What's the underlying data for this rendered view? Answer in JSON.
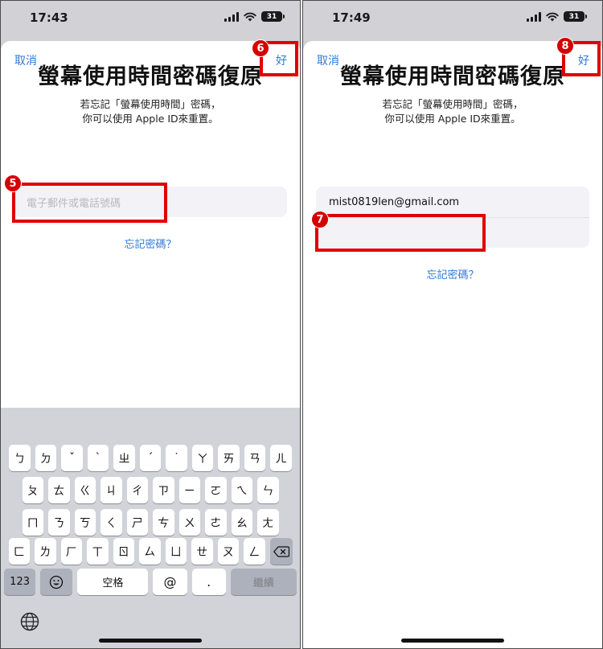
{
  "left": {
    "status_time": "17:43",
    "battery_level": "31",
    "cancel_label": "取消",
    "done_label": "好",
    "title": "螢幕使用時間密碼復原",
    "subtitle_line1": "若忘記「螢幕使用時間」密碼，",
    "subtitle_line2": "你可以使用 Apple ID來重置。",
    "account_placeholder": "電子郵件或電話號碼",
    "forgot_label": "忘記密碼？",
    "badges": [
      "5",
      "6"
    ],
    "keyboard": {
      "row1": [
        "ㄅ",
        "ㄉ",
        "ˇ",
        "ˋ",
        "ㄓ",
        "ˊ",
        "˙",
        "ㄚ",
        "ㄞ",
        "ㄢ",
        "ㄦ"
      ],
      "row2": [
        "ㄆ",
        "ㄊ",
        "ㄍ",
        "ㄐ",
        "ㄔ",
        "ㄗ",
        "ㄧ",
        "ㄛ",
        "ㄟ",
        "ㄣ"
      ],
      "row3": [
        "ㄇ",
        "ㄋ",
        "ㄎ",
        "ㄑ",
        "ㄕ",
        "ㄘ",
        "ㄨ",
        "ㄜ",
        "ㄠ",
        "ㄤ"
      ],
      "row4": [
        "ㄈ",
        "ㄌ",
        "ㄏ",
        "ㄒ",
        "ㄖ",
        "ㄙ",
        "ㄩ",
        "ㄝ",
        "ㄡ",
        "ㄥ"
      ],
      "numbers_label": "123",
      "space_label": "空格",
      "at_label": "@",
      "dot_label": ".",
      "continue_label": "繼續"
    }
  },
  "right": {
    "status_time": "17:49",
    "battery_level": "31",
    "cancel_label": "取消",
    "done_label": "好",
    "title": "螢幕使用時間密碼復原",
    "subtitle_line1": "若忘記「螢幕使用時間」密碼，",
    "subtitle_line2": "你可以使用 Apple ID來重置。",
    "account_value": "mist0819len@gmail.com",
    "password_value": "",
    "forgot_label": "忘記密碼？",
    "badges": [
      "7",
      "8"
    ]
  },
  "colors": {
    "accent": "#2f7ad8",
    "callout": "#e00000",
    "badge": "#d40000",
    "keyboard_bg": "#d1d3d9"
  },
  "icons": {
    "signal": "cellular-signal-icon",
    "wifi": "wifi-icon",
    "battery": "battery-icon",
    "emoji": "emoji-icon",
    "delete": "backspace-icon",
    "globe": "globe-icon"
  }
}
